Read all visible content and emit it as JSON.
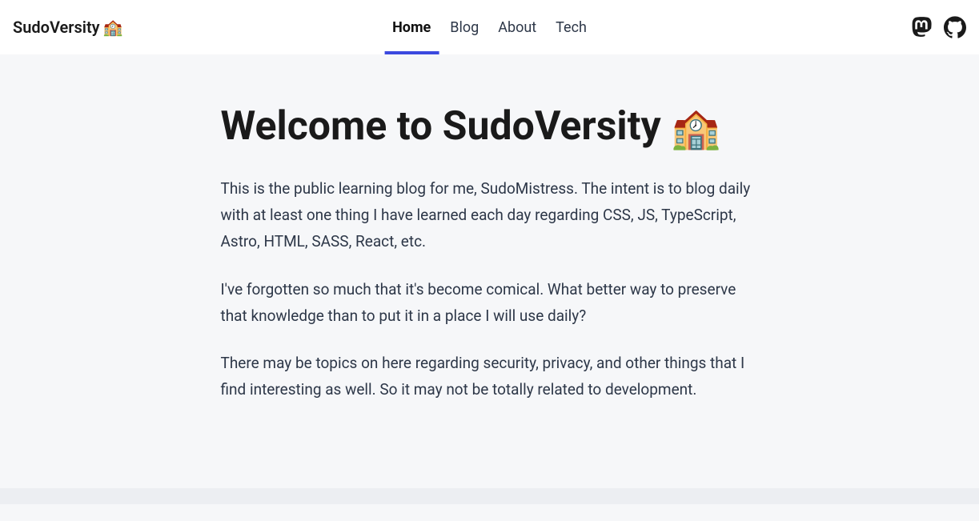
{
  "brand": {
    "name": "SudoVersity",
    "emoji": "🏫"
  },
  "nav": {
    "items": [
      {
        "label": "Home",
        "active": true
      },
      {
        "label": "Blog",
        "active": false
      },
      {
        "label": "About",
        "active": false
      },
      {
        "label": "Tech",
        "active": false
      }
    ]
  },
  "social": {
    "mastodon": "mastodon",
    "github": "github"
  },
  "main": {
    "title": "Welcome to SudoVersity",
    "title_emoji": "🏫",
    "paragraphs": [
      "This is the public learning blog for me, SudoMistress. The intent is to blog daily with at least one thing I have learned each day regarding CSS, JS, TypeScript, Astro, HTML, SASS, React, etc.",
      "I've forgotten so much that it's become comical. What better way to preserve that knowledge than to put it in a place I will use daily?",
      "There may be topics on here regarding security, privacy, and other things that I find interesting as well. So it may not be totally related to development."
    ]
  }
}
